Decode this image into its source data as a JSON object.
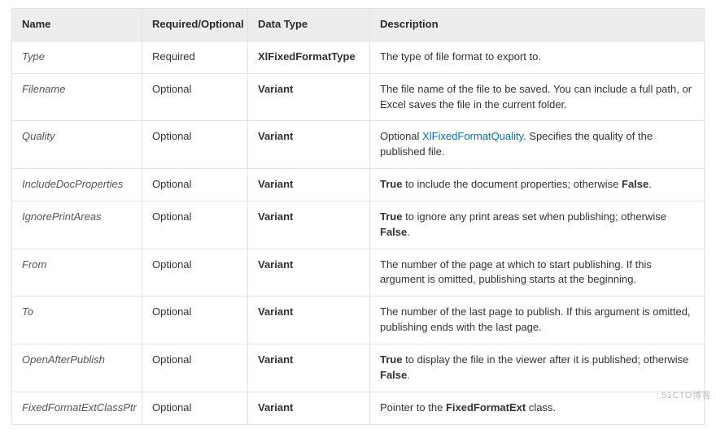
{
  "headers": {
    "name": "Name",
    "required": "Required/Optional",
    "dataType": "Data Type",
    "description": "Description"
  },
  "rows": [
    {
      "name": "Type",
      "required": "Required",
      "dataType": "XlFixedFormatType",
      "desc": [
        {
          "t": "text",
          "v": "The type of file format to export to."
        }
      ]
    },
    {
      "name": "Filename",
      "required": "Optional",
      "dataType": "Variant",
      "desc": [
        {
          "t": "text",
          "v": "The file name of the file to be saved. You can include a full path, or Excel saves the file in the current folder."
        }
      ]
    },
    {
      "name": "Quality",
      "required": "Optional",
      "dataType": "Variant",
      "desc": [
        {
          "t": "text",
          "v": "Optional "
        },
        {
          "t": "link",
          "v": "XlFixedFormatQuality"
        },
        {
          "t": "text",
          "v": ". Specifies the quality of the published file."
        }
      ]
    },
    {
      "name": "IncludeDocProperties",
      "required": "Optional",
      "dataType": "Variant",
      "desc": [
        {
          "t": "bold",
          "v": "True"
        },
        {
          "t": "text",
          "v": " to include the document properties; otherwise "
        },
        {
          "t": "bold",
          "v": "False"
        },
        {
          "t": "text",
          "v": "."
        }
      ]
    },
    {
      "name": "IgnorePrintAreas",
      "required": "Optional",
      "dataType": "Variant",
      "desc": [
        {
          "t": "bold",
          "v": "True"
        },
        {
          "t": "text",
          "v": " to ignore any print areas set when publishing; otherwise "
        },
        {
          "t": "bold",
          "v": "False"
        },
        {
          "t": "text",
          "v": "."
        }
      ]
    },
    {
      "name": "From",
      "required": "Optional",
      "dataType": "Variant",
      "desc": [
        {
          "t": "text",
          "v": "The number of the page at which to start publishing. If this argument is omitted, publishing starts at the beginning."
        }
      ]
    },
    {
      "name": "To",
      "required": "Optional",
      "dataType": "Variant",
      "desc": [
        {
          "t": "text",
          "v": "The number of the last page to publish. If this argument is omitted, publishing ends with the last page."
        }
      ]
    },
    {
      "name": "OpenAfterPublish",
      "required": "Optional",
      "dataType": "Variant",
      "desc": [
        {
          "t": "bold",
          "v": "True"
        },
        {
          "t": "text",
          "v": " to display the file in the viewer after it is published; otherwise "
        },
        {
          "t": "bold",
          "v": "False"
        },
        {
          "t": "text",
          "v": "."
        }
      ]
    },
    {
      "name": "FixedFormatExtClassPtr",
      "required": "Optional",
      "dataType": "Variant",
      "desc": [
        {
          "t": "text",
          "v": "Pointer to the "
        },
        {
          "t": "bold",
          "v": "FixedFormatExt"
        },
        {
          "t": "text",
          "v": " class."
        }
      ]
    }
  ],
  "watermark": "51CTO博客"
}
